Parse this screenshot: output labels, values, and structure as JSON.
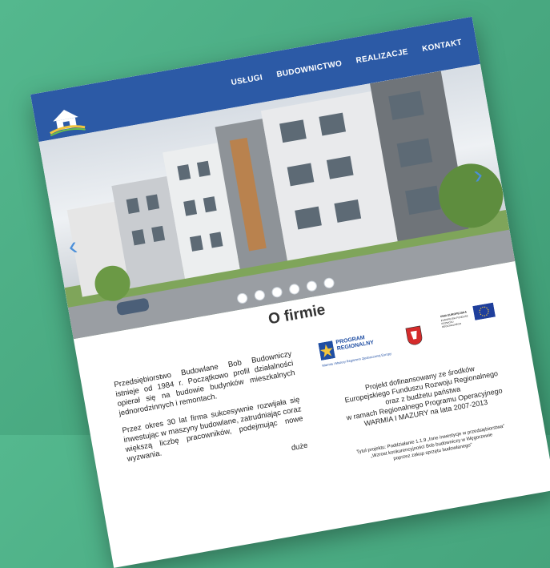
{
  "nav": {
    "items": [
      "USŁUGI",
      "BUDOWNICTWO",
      "REALIZACJE",
      "KONTAKT"
    ]
  },
  "hero": {
    "prev_arrow": "‹",
    "next_arrow": "›",
    "slide_count": 6
  },
  "section": {
    "title": "O firmie",
    "para1": "Przedsiębiorstwo Budowlane Bob Budowniczy istnieje od 1984 r. Początkowo profil działalności opierał się na budowie budynków mieszkalnych jednorodzinnych i remontach.",
    "para2": "Przez okres 30 lat firma sukcesywnie rozwijała się inwestując w maszyny budowlane, zatrudniając coraz większą liczbę pracowników, podejmując nowe wyzwania.",
    "para3_fragment": "duże"
  },
  "funding": {
    "program_logo_line1": "PROGRAM",
    "program_logo_line2": "REGIONALNY",
    "program_caption": "Warmia i Mazury Regionem Zjednoczonej Europy",
    "ue_caption_1": "UNIA EUROPEJSKA",
    "ue_caption_2": "EUROPEJSKI FUNDUSZ ROZWOJU REGIONALNEGO",
    "line1": "Projekt dofinansowany ze środków",
    "line2": "Europejskiego Funduszu Rozwoju Regionalnego",
    "line3": "oraz z budżetu państwa",
    "line4": "w ramach Regionalnego Programu Operacyjnego",
    "line5": "WARMIA I MAZURY na lata 2007-2013",
    "small1": "Tytuł projektu: Poddziałanie 1.1.9 „Inne inwestycje w przedsiębiorstwa”",
    "small2": "„Wzrost konkurencyjności Bob budowniczy w Węgorzewie",
    "small3": "poprzez zakup sprzętu budowlanego”"
  },
  "colors": {
    "background": "#4fb488",
    "navbar": "#2c5aa6",
    "arrow": "#4b8fd9"
  }
}
